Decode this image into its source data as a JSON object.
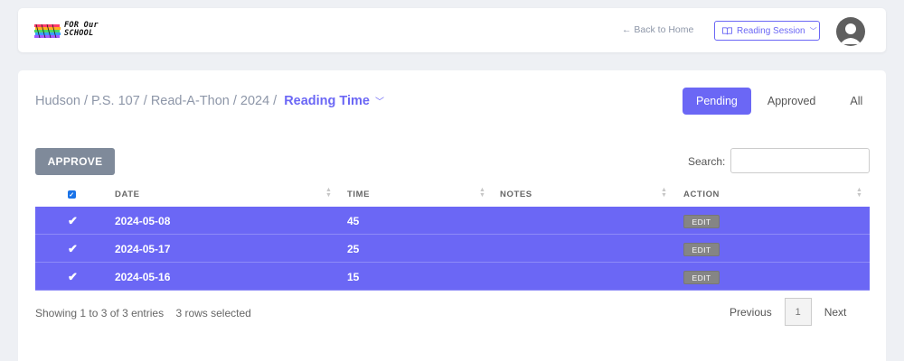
{
  "header": {
    "logo_text": "FOR Our\nSCHOOL",
    "back_link": "← Back to Home",
    "session_label": "Reading Session"
  },
  "breadcrumb": {
    "items": [
      "Hudson",
      "P.S. 107",
      "Read-A-Thon",
      "2024"
    ],
    "current": "Reading Time"
  },
  "filters": {
    "pending": "Pending",
    "approved": "Approved",
    "all": "All",
    "active": "Pending"
  },
  "toolbar": {
    "approve_label": "APPROVE",
    "search_label": "Search:",
    "search_value": ""
  },
  "table": {
    "columns": {
      "date": "DATE",
      "time": "TIME",
      "notes": "NOTES",
      "action": "ACTION"
    },
    "rows": [
      {
        "date": "2024-05-08",
        "time": "45",
        "notes": "",
        "action": "EDIT"
      },
      {
        "date": "2024-05-17",
        "time": "25",
        "notes": "",
        "action": "EDIT"
      },
      {
        "date": "2024-05-16",
        "time": "15",
        "notes": "",
        "action": "EDIT"
      }
    ]
  },
  "footer": {
    "showing": "Showing 1 to 3 of 3 entries",
    "selected": "3 rows selected",
    "previous": "Previous",
    "page": "1",
    "next": "Next"
  },
  "colors": {
    "accent": "#6b67f5",
    "approve_button": "#7f8a9a"
  }
}
